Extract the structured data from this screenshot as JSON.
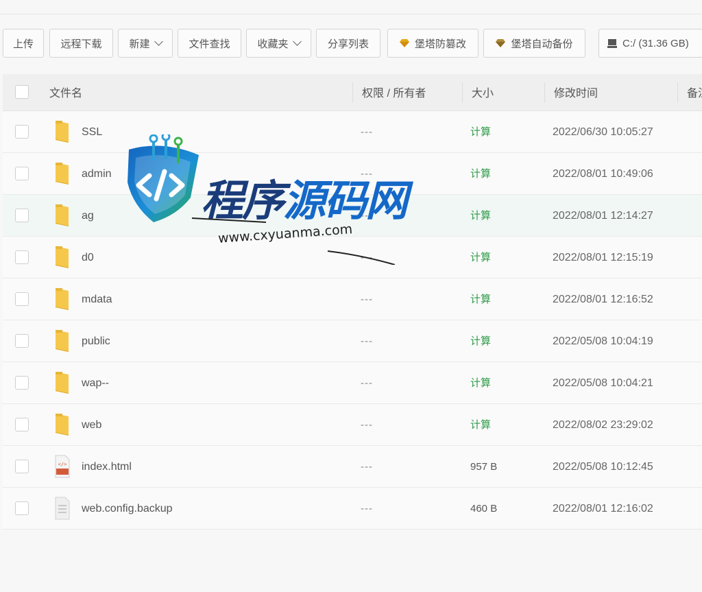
{
  "toolbar": {
    "upload": "上传",
    "remote_download": "远程下载",
    "new": "新建",
    "file_search": "文件查找",
    "favorites": "收藏夹",
    "share_list": "分享列表",
    "tamper_proof": "堡塔防篡改",
    "auto_backup": "堡塔自动备份",
    "disk": "C:/ (31.36 GB)"
  },
  "table": {
    "headers": {
      "name": "文件名",
      "permission": "权限 / 所有者",
      "size": "大小",
      "mtime": "修改时间",
      "extra": "备注"
    },
    "rows": [
      {
        "name": "SSL",
        "permission": "---",
        "size": "计算",
        "mtime": "2022/06/30 10:05:27"
      },
      {
        "name": "admin",
        "permission": "---",
        "size": "计算",
        "mtime": "2022/08/01 10:49:06"
      },
      {
        "name": "ag",
        "permission": "---",
        "size": "计算",
        "mtime": "2022/08/01 12:14:27"
      },
      {
        "name": "d0",
        "permission": "---",
        "size": "计算",
        "mtime": "2022/08/01 12:15:19"
      },
      {
        "name": "mdata",
        "permission": "---",
        "size": "计算",
        "mtime": "2022/08/01 12:16:52"
      },
      {
        "name": "public",
        "permission": "---",
        "size": "计算",
        "mtime": "2022/05/08 10:04:19"
      },
      {
        "name": "wap--",
        "permission": "---",
        "size": "计算",
        "mtime": "2022/05/08 10:04:21"
      },
      {
        "name": "web",
        "permission": "---",
        "size": "计算",
        "mtime": "2022/08/02 23:29:02"
      },
      {
        "name": "index.html",
        "permission": "---",
        "size": "957 B",
        "mtime": "2022/05/08 10:12:45"
      },
      {
        "name": "web.config.backup",
        "permission": "---",
        "size": "460 B",
        "mtime": "2022/08/01 12:16:02"
      }
    ]
  },
  "row_icons": [
    "folder-icon",
    "folder-icon",
    "folder-icon",
    "folder-icon",
    "folder-icon",
    "folder-icon",
    "folder-icon",
    "folder-icon",
    "html-file-icon",
    "text-file-icon"
  ],
  "highlighted_row": "ag",
  "watermark": {
    "title_part1": "程序",
    "title_part2": "源码网",
    "url": "www.cxyuanma.com"
  },
  "colors": {
    "calc_green": "#2e9b48",
    "folder_yellow": "#f5c84c",
    "gem_gold": "#e6a817",
    "highlight_row": "#f0f7f5"
  }
}
